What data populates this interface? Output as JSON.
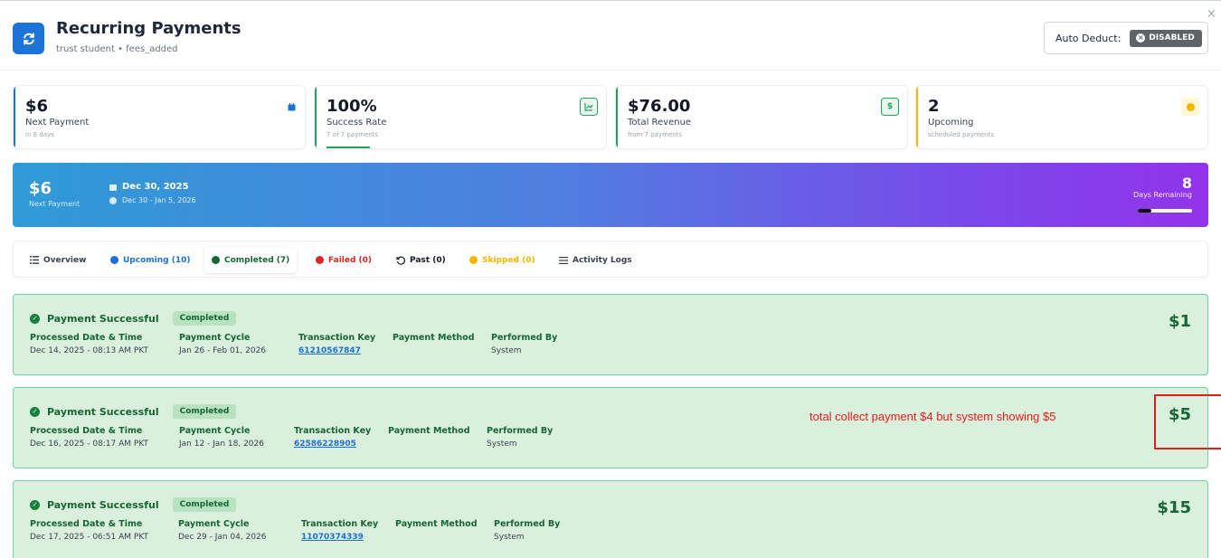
{
  "header": {
    "title": "Recurring Payments",
    "subtitle": "trust student • fees_added",
    "auto_deduct_label": "Auto Deduct:",
    "auto_deduct_status": "DISABLED",
    "close_symbol": "×",
    "icon": "refresh-icon"
  },
  "stats": [
    {
      "value": "$6",
      "label": "Next Payment",
      "sub": "in 8 days",
      "accent": "#1d74d8",
      "icon": "calendar-icon"
    },
    {
      "value": "100%",
      "label": "Success Rate",
      "sub": "7 of 7 payments",
      "accent": "#22a35a",
      "icon": "chart-icon"
    },
    {
      "value": "$76.00",
      "label": "Total Revenue",
      "sub": "from 7 payments",
      "accent": "#22a35a",
      "icon": "dollar-icon"
    },
    {
      "value": "2",
      "label": "Upcoming",
      "sub": "scheduled payments",
      "accent": "#f5b400",
      "icon": "clock-icon"
    }
  ],
  "banner": {
    "amount": "$6",
    "amount_label": "Next Payment",
    "date": "Dec 30, 2025",
    "range": "Dec 30 - Jan 5, 2026",
    "days": "8",
    "days_label": "Days Remaining",
    "progress": 0.25
  },
  "tabs": [
    {
      "label": "Overview",
      "color": "#374151",
      "icon": "list-icon"
    },
    {
      "label": "Upcoming (10)",
      "color": "#1d6fd8",
      "icon": "clock-icon"
    },
    {
      "label": "Completed (7)",
      "color": "#166534",
      "icon": "check-circle-icon",
      "active": true
    },
    {
      "label": "Failed (0)",
      "color": "#dc2626",
      "icon": "x-circle-icon"
    },
    {
      "label": "Past (0)",
      "color": "#111827",
      "icon": "history-icon"
    },
    {
      "label": "Skipped (0)",
      "color": "#f5b400",
      "icon": "skip-icon"
    },
    {
      "label": "Activity Logs",
      "color": "#374151",
      "icon": "menu-icon"
    }
  ],
  "columns": {
    "processed": "Processed Date & Time",
    "cycle": "Payment Cycle",
    "key": "Transaction Key",
    "method": "Payment Method",
    "by": "Performed By"
  },
  "payments": [
    {
      "status": "Payment Successful",
      "badge": "Completed",
      "processed": "Dec 14, 2025 - 08:13 AM PKT",
      "cycle": "Jan 26 - Feb 01, 2026",
      "key": "61210567847",
      "method": "",
      "by": "System",
      "amount": "$1"
    },
    {
      "status": "Payment Successful",
      "badge": "Completed",
      "processed": "Dec 16, 2025 - 08:17 AM PKT",
      "cycle": "Jan 12 - Jan 18, 2026",
      "key": "62586228905",
      "method": "",
      "by": "System",
      "amount": "$5"
    },
    {
      "status": "Payment Successful",
      "badge": "Completed",
      "processed": "Dec 17, 2025 - 06:51 AM PKT",
      "cycle": "Dec 29 - Jan 04, 2026",
      "key": "11070374339",
      "method": "",
      "by": "System",
      "amount": "$15"
    }
  ],
  "annotation": "total collect payment $4 but system showing $5"
}
